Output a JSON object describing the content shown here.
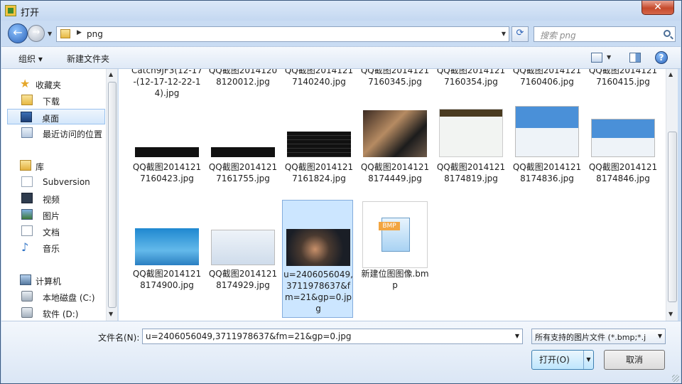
{
  "window": {
    "title": "打开",
    "close_label": "✕"
  },
  "address": {
    "path": "png",
    "search_placeholder": "搜索 png"
  },
  "toolbar": {
    "organize": "组织 ▾",
    "new_folder": "新建文件夹"
  },
  "nav": {
    "favorites": "收藏夹",
    "downloads": "下载",
    "desktop": "桌面",
    "recent": "最近访问的位置",
    "libraries": "库",
    "subversion": "Subversion",
    "videos": "视频",
    "pictures": "图片",
    "documents": "文档",
    "music": "音乐",
    "computer": "计算机",
    "local_disk": "本地磁盘 (C:)",
    "software": "软件 (D:)"
  },
  "files": [
    {
      "name": "Catch9JF3(12-17-(12-17-12-22-14).jpg"
    },
    {
      "name": "QQ截图20141208120012.jpg"
    },
    {
      "name": "QQ截图20141217140240.jpg"
    },
    {
      "name": "QQ截图20141217160345.jpg"
    },
    {
      "name": "QQ截图20141217160354.jpg"
    },
    {
      "name": "QQ截图20141217160406.jpg"
    },
    {
      "name": "QQ截图20141217160415.jpg"
    },
    {
      "name": "QQ截图20141217160423.jpg"
    },
    {
      "name": "QQ截图20141217161755.jpg"
    },
    {
      "name": "QQ截图20141217161824.jpg"
    },
    {
      "name": "QQ截图20141218174449.jpg"
    },
    {
      "name": "QQ截图20141218174819.jpg"
    },
    {
      "name": "QQ截图20141218174836.jpg"
    },
    {
      "name": "QQ截图20141218174846.jpg"
    },
    {
      "name": "QQ截图20141218174900.jpg"
    },
    {
      "name": "QQ截图20141218174929.jpg"
    },
    {
      "name": "u=2406056049,3711978637&fm=21&gp=0.jpg"
    },
    {
      "name": "新建位图图像.bmp",
      "badge": "BMP"
    }
  ],
  "bottom": {
    "filename_label": "文件名(N):",
    "filename_value": "u=2406056049,3711978637&fm=21&gp=0.jpg",
    "filetype_value": "所有支持的图片文件 (*.bmp;*.j",
    "open_label": "打开(O)",
    "cancel_label": "取消"
  }
}
